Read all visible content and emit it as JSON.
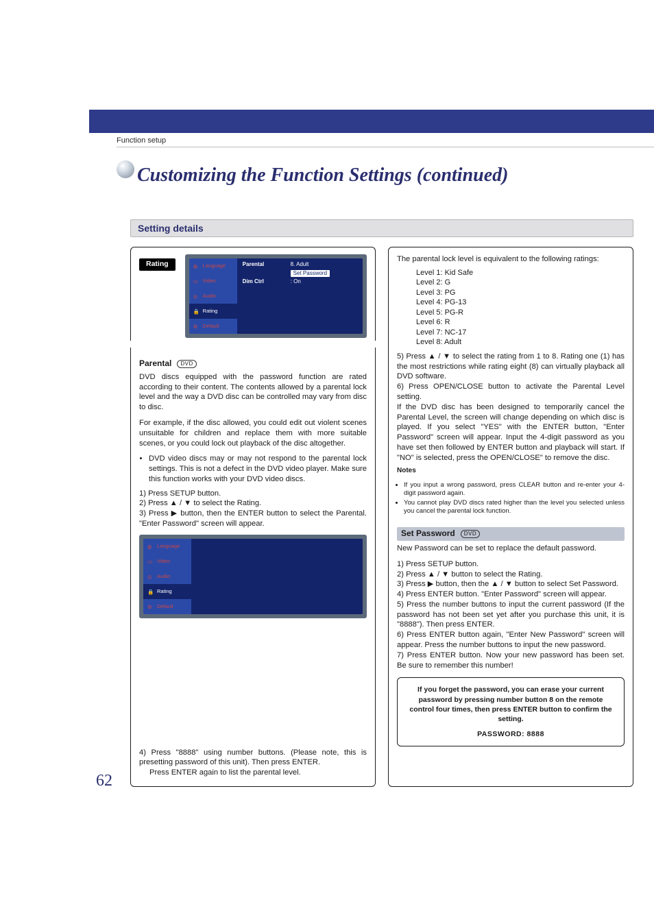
{
  "breadcrumb": "Function setup",
  "page_title": "Customizing the Function Settings (continued)",
  "section_title": "Setting details",
  "page_number": "62",
  "rating_label": "Rating",
  "dvd_chip": "DVD",
  "osd1": {
    "tabs": [
      "Language",
      "Video",
      "Audio",
      "Rating",
      "Default"
    ],
    "rows": [
      {
        "k": "Parental",
        "v": "8. Adult"
      },
      {
        "k": "",
        "hl": "Set Password"
      },
      {
        "k": "Dim Ctrl",
        "v": ": On"
      }
    ]
  },
  "osd2": {
    "tabs": [
      "Language",
      "Video",
      "Audio",
      "Rating",
      "Default"
    ]
  },
  "parental": {
    "heading": "Parental",
    "p1": "DVD discs equipped with the password function are rated according to their content. The contents allowed by a parental lock level and the way a DVD disc can be controlled may vary from disc to disc.",
    "p2": "For example, if the disc allowed, you could edit out violent scenes unsuitable for children and replace them with more suitable scenes, or you could lock out playback of the disc altogether.",
    "bullet": "DVD video discs may or may not respond to the parental lock settings. This is not a defect in the DVD video player. Make sure this function works with your DVD video discs.",
    "step1": "Press SETUP button.",
    "step2a": "Press ▲ / ▼  to select the Rating.",
    "step3a": "Press ▶ button, then the ENTER button to select the Parental. \"Enter Password\" screen will appear.",
    "step4a": "Press \"8888\" using number buttons. (Please note, this is presetting password of this unit). Then press ENTER.",
    "step4b": "Press ENTER again to list the parental level.",
    "intro_levels": "The parental lock level is equivalent to the following ratings:",
    "levels": [
      "Level 1: Kid Safe",
      "Level 2: G",
      "Level 3: PG",
      "Level 4: PG-13",
      "Level 5: PG-R",
      "Level 6: R",
      "Level 7: NC-17",
      "Level 8: Adult"
    ],
    "step5": "Press ▲ / ▼ to select the rating from 1 to 8. Rating one (1) has the most restrictions while rating eight (8) can virtually playback all DVD software.",
    "step6": "Press OPEN/CLOSE button to activate the Parental Level setting.\nIf the DVD disc has been designed to temporarily cancel the Parental Level, the screen will change depending on which disc is played. If you select \"YES\" with the ENTER button, \"Enter Password\" screen will appear. Input the 4-digit password as you have set then followed by ENTER button and playback will start. If \"NO\" is selected, press the OPEN/CLOSE\" to remove the disc.",
    "notes_head": "Notes",
    "note1": "If you input a wrong password, press CLEAR button and re-enter your 4-digit password again.",
    "note2": "You cannot play DVD discs rated higher than the level you selected unless you cancel  the parental lock function."
  },
  "setpass": {
    "heading": "Set Password",
    "p1": "New Password can be set to replace the default password.",
    "step1": "Press SETUP button.",
    "step2": "Press ▲ / ▼ button to select the Rating.",
    "step3": "Press ▶ button, then the ▲ / ▼ button to select Set Password.",
    "step4": "Press ENTER button. \"Enter Password\" screen will appear.",
    "step5": "Press the number buttons to input the current password (If the password has not been set yet after you purchase this unit, it is \"8888\"). Then press ENTER.",
    "step6": "Press ENTER button again, \"Enter New Password\" screen will appear. Press the number buttons to input the new password.",
    "step7": "Press ENTER button. Now your new password has been set.  Be sure to remember this number!"
  },
  "forgot": {
    "text": "If you forget the password, you can erase your current password by pressing number button 8 on the remote control four times, then press ENTER button to confirm the setting.",
    "pw": "PASSWORD: 8888"
  }
}
